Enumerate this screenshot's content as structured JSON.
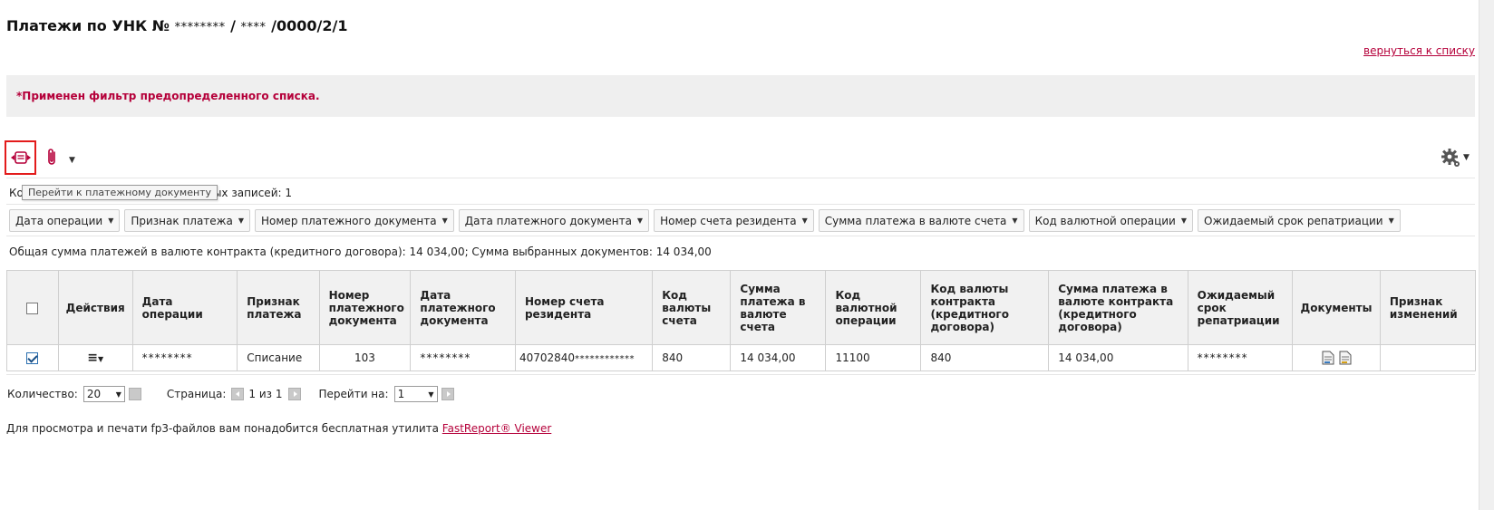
{
  "header": {
    "title_prefix": "Платежи по УНК №",
    "title_mask1": "********",
    "title_sep": " / ",
    "title_mask2": "****",
    "title_suffix": "/0000/2/1",
    "back_link": "вернуться к списку"
  },
  "filter_banner": {
    "text": "*Применен фильтр предопределенного списка."
  },
  "toolbar": {
    "goto_icon": "goto-document-icon",
    "attach_icon": "paperclip-icon",
    "settings_icon": "gear-icon",
    "tooltip": "Перейти к платежному документу"
  },
  "selection": {
    "prefix": "Ко",
    "suffix": "бранных записей: 1"
  },
  "filters": [
    "Дата операции",
    "Признак платежа",
    "Номер платежного документа",
    "Дата платежного документа",
    "Номер счета резидента",
    "Сумма платежа в валюте счета",
    "Код валютной операции",
    "Ожидаемый срок репатриации"
  ],
  "summary": {
    "text": "Общая сумма платежей в валюте контракта (кредитного договора): 14 034,00; Сумма выбранных документов: 14 034,00"
  },
  "table": {
    "columns": [
      "",
      "Действия",
      "Дата операции",
      "Признак платежа",
      "Номер платежного документа",
      "Дата платежного документа",
      "Номер счета резидента",
      "Код валюты счета",
      "Сумма платежа в валюте счета",
      "Код валютной операции",
      "Код валюты контракта (кредитного договора)",
      "Сумма платежа в валюте контракта (кредитного договора)",
      "Ожидаемый срок репатриации",
      "Документы",
      "Признак изменений"
    ],
    "rows": [
      {
        "checked": true,
        "actions_icon": "menu-icon",
        "operation_date": "********",
        "payment_type": "Списание",
        "doc_number": "103",
        "doc_date": "********",
        "account_prefix": "40702840",
        "account_mask": "************",
        "account_currency": "840",
        "amount_account": "14 034,00",
        "operation_code": "11100",
        "contract_currency": "840",
        "amount_contract": "14 034,00",
        "repatriation_date": "********",
        "doc_icons": [
          "document-icon",
          "document-edit-icon"
        ],
        "changes": ""
      }
    ]
  },
  "pager": {
    "count_label": "Количество:",
    "count_value": "20",
    "page_label": "Страница:",
    "page_of": "1 из 1",
    "goto_label": "Перейти на:",
    "goto_value": "1"
  },
  "footer": {
    "text": "Для просмотра и печати fp3-файлов вам понадобится бесплатная утилита ",
    "link": "FastReport® Viewer"
  }
}
